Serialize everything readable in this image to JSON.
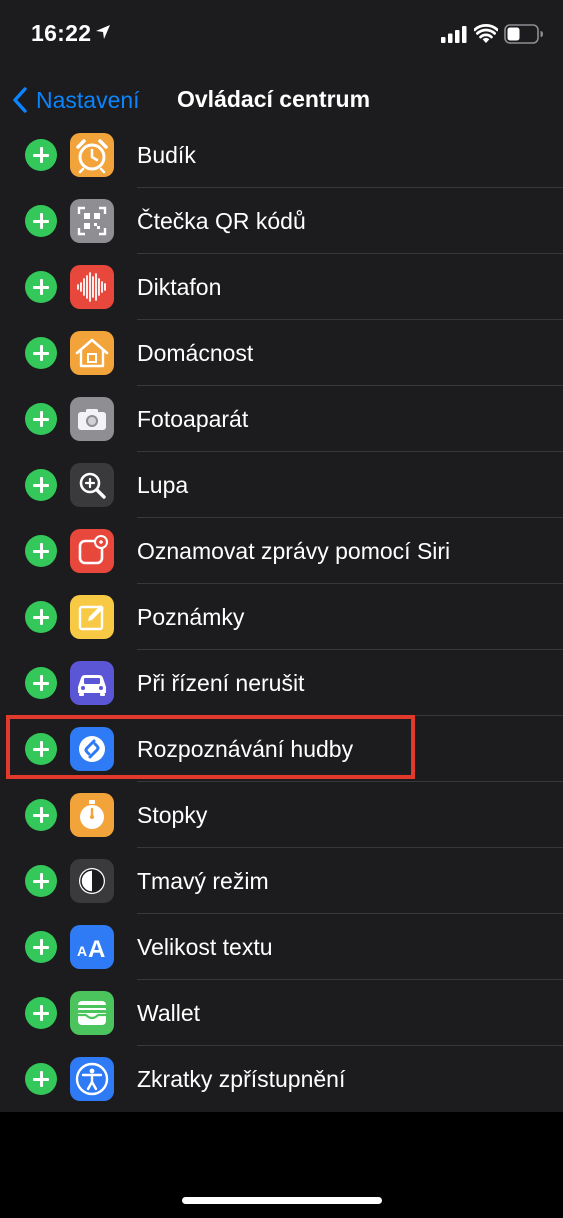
{
  "status_bar": {
    "time": "16:22"
  },
  "nav": {
    "back_label": "Nastavení",
    "title": "Ovládací centrum"
  },
  "items": [
    {
      "label": "Budík",
      "icon": "alarm-clock-icon",
      "color": "#f2a33a"
    },
    {
      "label": "Čtečka QR kódů",
      "icon": "qr-code-icon",
      "color": "#8e8e93"
    },
    {
      "label": "Diktafon",
      "icon": "waveform-icon",
      "color": "#e8473c"
    },
    {
      "label": "Domácnost",
      "icon": "home-icon",
      "color": "#f2a33a"
    },
    {
      "label": "Fotoaparát",
      "icon": "camera-icon",
      "color": "#8e8e93"
    },
    {
      "label": "Lupa",
      "icon": "magnifier-icon",
      "color": "#3a3a3c"
    },
    {
      "label": "Oznamovat zprávy pomocí Siri",
      "icon": "announce-messages-icon",
      "color": "#e8473c"
    },
    {
      "label": "Poznámky",
      "icon": "notes-icon",
      "color": "#f7c945"
    },
    {
      "label": "Při řízení nerušit",
      "icon": "car-icon",
      "color": "#5b56d6"
    },
    {
      "label": "Rozpoznávání hudby",
      "icon": "shazam-icon",
      "color": "#2f7bf5"
    },
    {
      "label": "Stopky",
      "icon": "stopwatch-icon",
      "color": "#f2a33a"
    },
    {
      "label": "Tmavý režim",
      "icon": "dark-mode-icon",
      "color": "#3a3a3c"
    },
    {
      "label": "Velikost textu",
      "icon": "text-size-icon",
      "color": "#2f7bf5"
    },
    {
      "label": "Wallet",
      "icon": "wallet-icon",
      "color": "#4cc45e"
    },
    {
      "label": "Zkratky zpřístupnění",
      "icon": "accessibility-icon",
      "color": "#2f7bf5"
    }
  ],
  "highlight_color": "#e1392b"
}
